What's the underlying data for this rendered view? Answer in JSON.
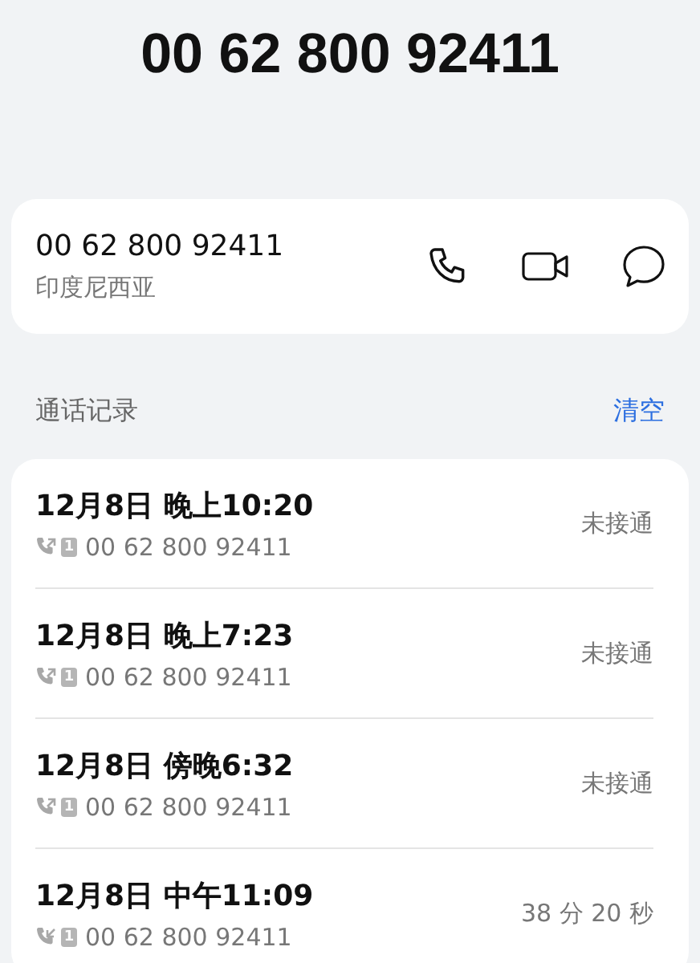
{
  "header": {
    "title": "00 62 800 92411"
  },
  "contact": {
    "number": "00 62 800 92411",
    "location": "印度尼西亚"
  },
  "history": {
    "title": "通话记录",
    "clear": "清空",
    "calls": [
      {
        "time": "12月8日 晚上10:20",
        "kind": "outgoing",
        "sim": "1",
        "number": "00 62 800 92411",
        "status": "未接通"
      },
      {
        "time": "12月8日 晚上7:23",
        "kind": "outgoing",
        "sim": "1",
        "number": "00 62 800 92411",
        "status": "未接通"
      },
      {
        "time": "12月8日 傍晚6:32",
        "kind": "outgoing",
        "sim": "1",
        "number": "00 62 800 92411",
        "status": "未接通"
      },
      {
        "time": "12月8日 中午11:09",
        "kind": "incoming",
        "sim": "1",
        "number": "00 62 800 92411",
        "status": "38 分 20 秒"
      }
    ]
  }
}
